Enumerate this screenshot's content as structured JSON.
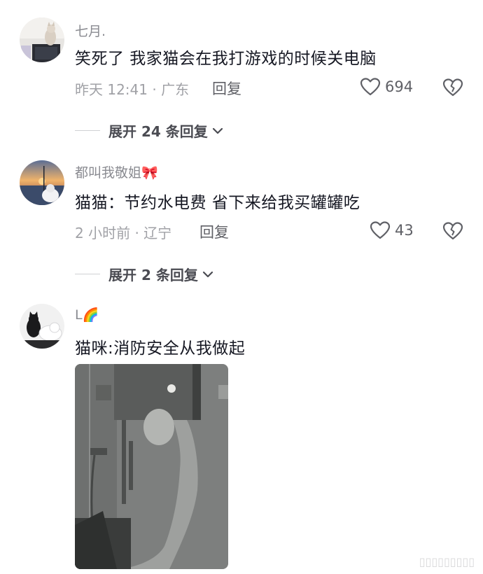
{
  "comments": [
    {
      "username": "七月.",
      "text": "笑死了 我家猫会在我打游戏的时候关电脑",
      "meta": "昨天 12:41 · 广东",
      "reply_label": "回复",
      "likes": "694",
      "expand_label": "展开 24 条回复",
      "avatar_icon": "avatar-cat-on-laptop"
    },
    {
      "username": "都叫我敬姐",
      "username_emoji": "🎀",
      "text": "猫猫：节约水电费 省下来给我买罐罐吃",
      "meta": "2 小时前 · 辽宁",
      "reply_label": "回复",
      "likes": "43",
      "expand_label": "展开 2 条回复",
      "avatar_icon": "avatar-sunset-sea"
    },
    {
      "username": "L",
      "username_emoji": "🌈",
      "text": "猫咪:消防安全从我做起",
      "avatar_icon": "avatar-black-white-cats",
      "image_icon": "cat-at-water-heater-photo"
    }
  ],
  "watermark": "▯▯▯▯▯▯▯▯▯",
  "colors": {
    "text_primary": "#161823",
    "text_secondary": "#a0a1a6",
    "username": "#8a8b91",
    "action": "#5f6066"
  }
}
